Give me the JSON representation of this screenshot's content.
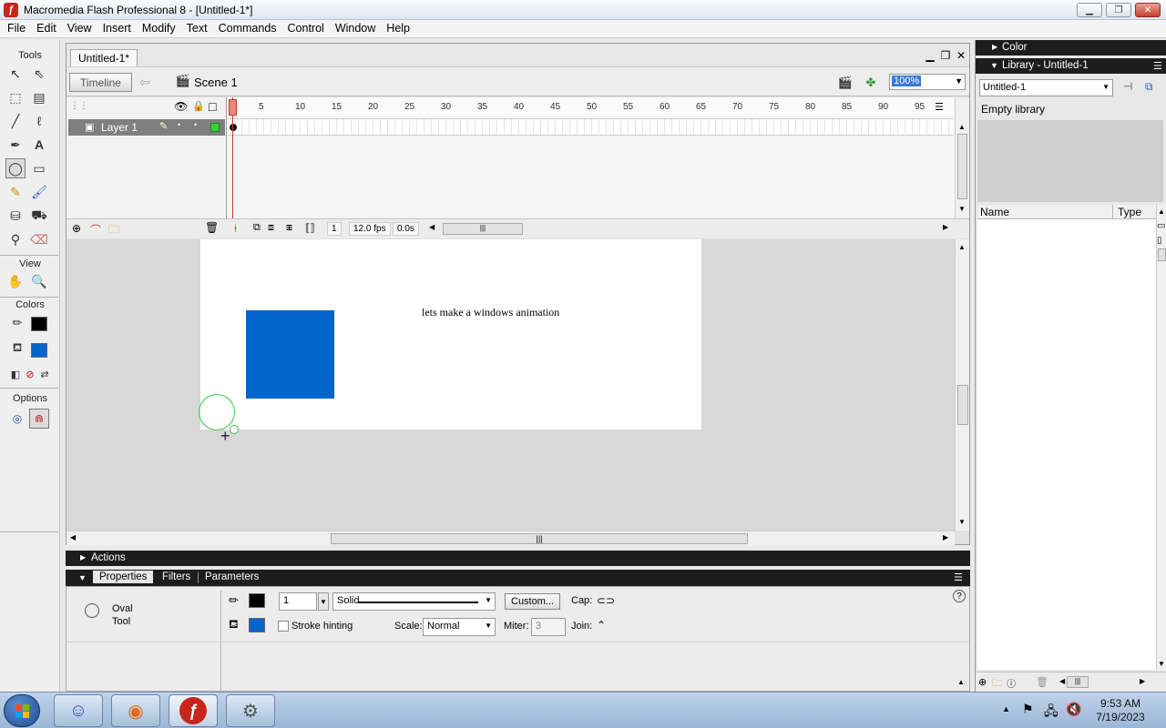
{
  "window": {
    "title": "Macromedia Flash Professional 8 - [Untitled-1*]",
    "icon": "flash-icon"
  },
  "menu": [
    "File",
    "Edit",
    "View",
    "Insert",
    "Modify",
    "Text",
    "Commands",
    "Control",
    "Window",
    "Help"
  ],
  "tools": {
    "heading": "Tools",
    "view_heading": "View",
    "colors_heading": "Colors",
    "options_heading": "Options",
    "selected": "oval-tool",
    "stroke_color": "#000000",
    "fill_color": "#0066cc"
  },
  "document": {
    "tab": "Untitled-1*",
    "timeline_button": "Timeline",
    "scene": "Scene 1",
    "zoom": "100%"
  },
  "timeline": {
    "layer_name": "Layer 1",
    "ruler_ticks": [
      "1",
      "5",
      "10",
      "15",
      "20",
      "25",
      "30",
      "35",
      "40",
      "45",
      "50",
      "55",
      "60",
      "65",
      "70",
      "75",
      "80",
      "85",
      "90",
      "95"
    ],
    "current_frame": "1",
    "frame_rate": "12.0 fps",
    "elapsed": "0.0s"
  },
  "stage": {
    "text": "lets make a windows animation",
    "rect_color": "#0066cc"
  },
  "panels": {
    "actions": "Actions",
    "tabs": [
      "Properties",
      "Filters",
      "Parameters"
    ]
  },
  "properties": {
    "tool_name_line1": "Oval",
    "tool_name_line2": "Tool",
    "stroke_width": "1",
    "stroke_style": "Solid",
    "custom_button": "Custom...",
    "cap_label": "Cap:",
    "stroke_hinting_label": "Stroke hinting",
    "scale_label": "Scale:",
    "scale_value": "Normal",
    "miter_label": "Miter:",
    "miter_value": "3",
    "join_label": "Join:"
  },
  "right": {
    "color_panel": "Color",
    "library_panel": "Library - Untitled-1",
    "library_select": "Untitled-1",
    "library_status": "Empty library",
    "col_name": "Name",
    "col_type": "Type"
  },
  "taskbar": {
    "time": "9:53 AM",
    "date": "7/19/2023"
  }
}
